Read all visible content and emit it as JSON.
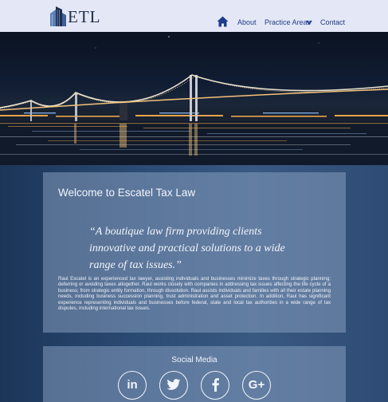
{
  "header": {
    "logo_text": "ETL",
    "nav": {
      "about": "About",
      "practice_areas": "Practice Areas",
      "contact": "Contact"
    }
  },
  "icons": {
    "home": "home-icon",
    "chevron": "chevron-down-icon",
    "social": [
      "linkedin-icon",
      "twitter-icon",
      "facebook-icon",
      "google-plus-icon"
    ]
  },
  "main": {
    "welcome_title": "Welcome to Escatel Tax Law",
    "quote": "“A boutique law firm providing clients innovative and practical solutions to a wide range of tax issues.”",
    "bio": "Raul Escatel is an experienced tax lawyer, assisting individuals and businesses minimize taxes through strategic planning; deferring or avoiding taxes altogether. Raul works closely with companies in addressing tax issues affecting the life cycle of a business; from strategic entity formation, through dissolution. Raul assists individuals and families with all their estate planning needs, including business succession planning, trust administration and asset protection. In addition, Raul has significant experience representing individuals and businesses before federal, state and local tax authorities in a wide range of tax disputes, including international tax issues."
  },
  "social": {
    "title": "Social Media",
    "buttons": {
      "linkedin": "in",
      "google_plus": "G+"
    }
  },
  "colors": {
    "header_bg": "#e4e7f5",
    "nav_link": "#1f3c8a",
    "page_bg": "#2b4a73",
    "card_bg": "#859cbe"
  }
}
